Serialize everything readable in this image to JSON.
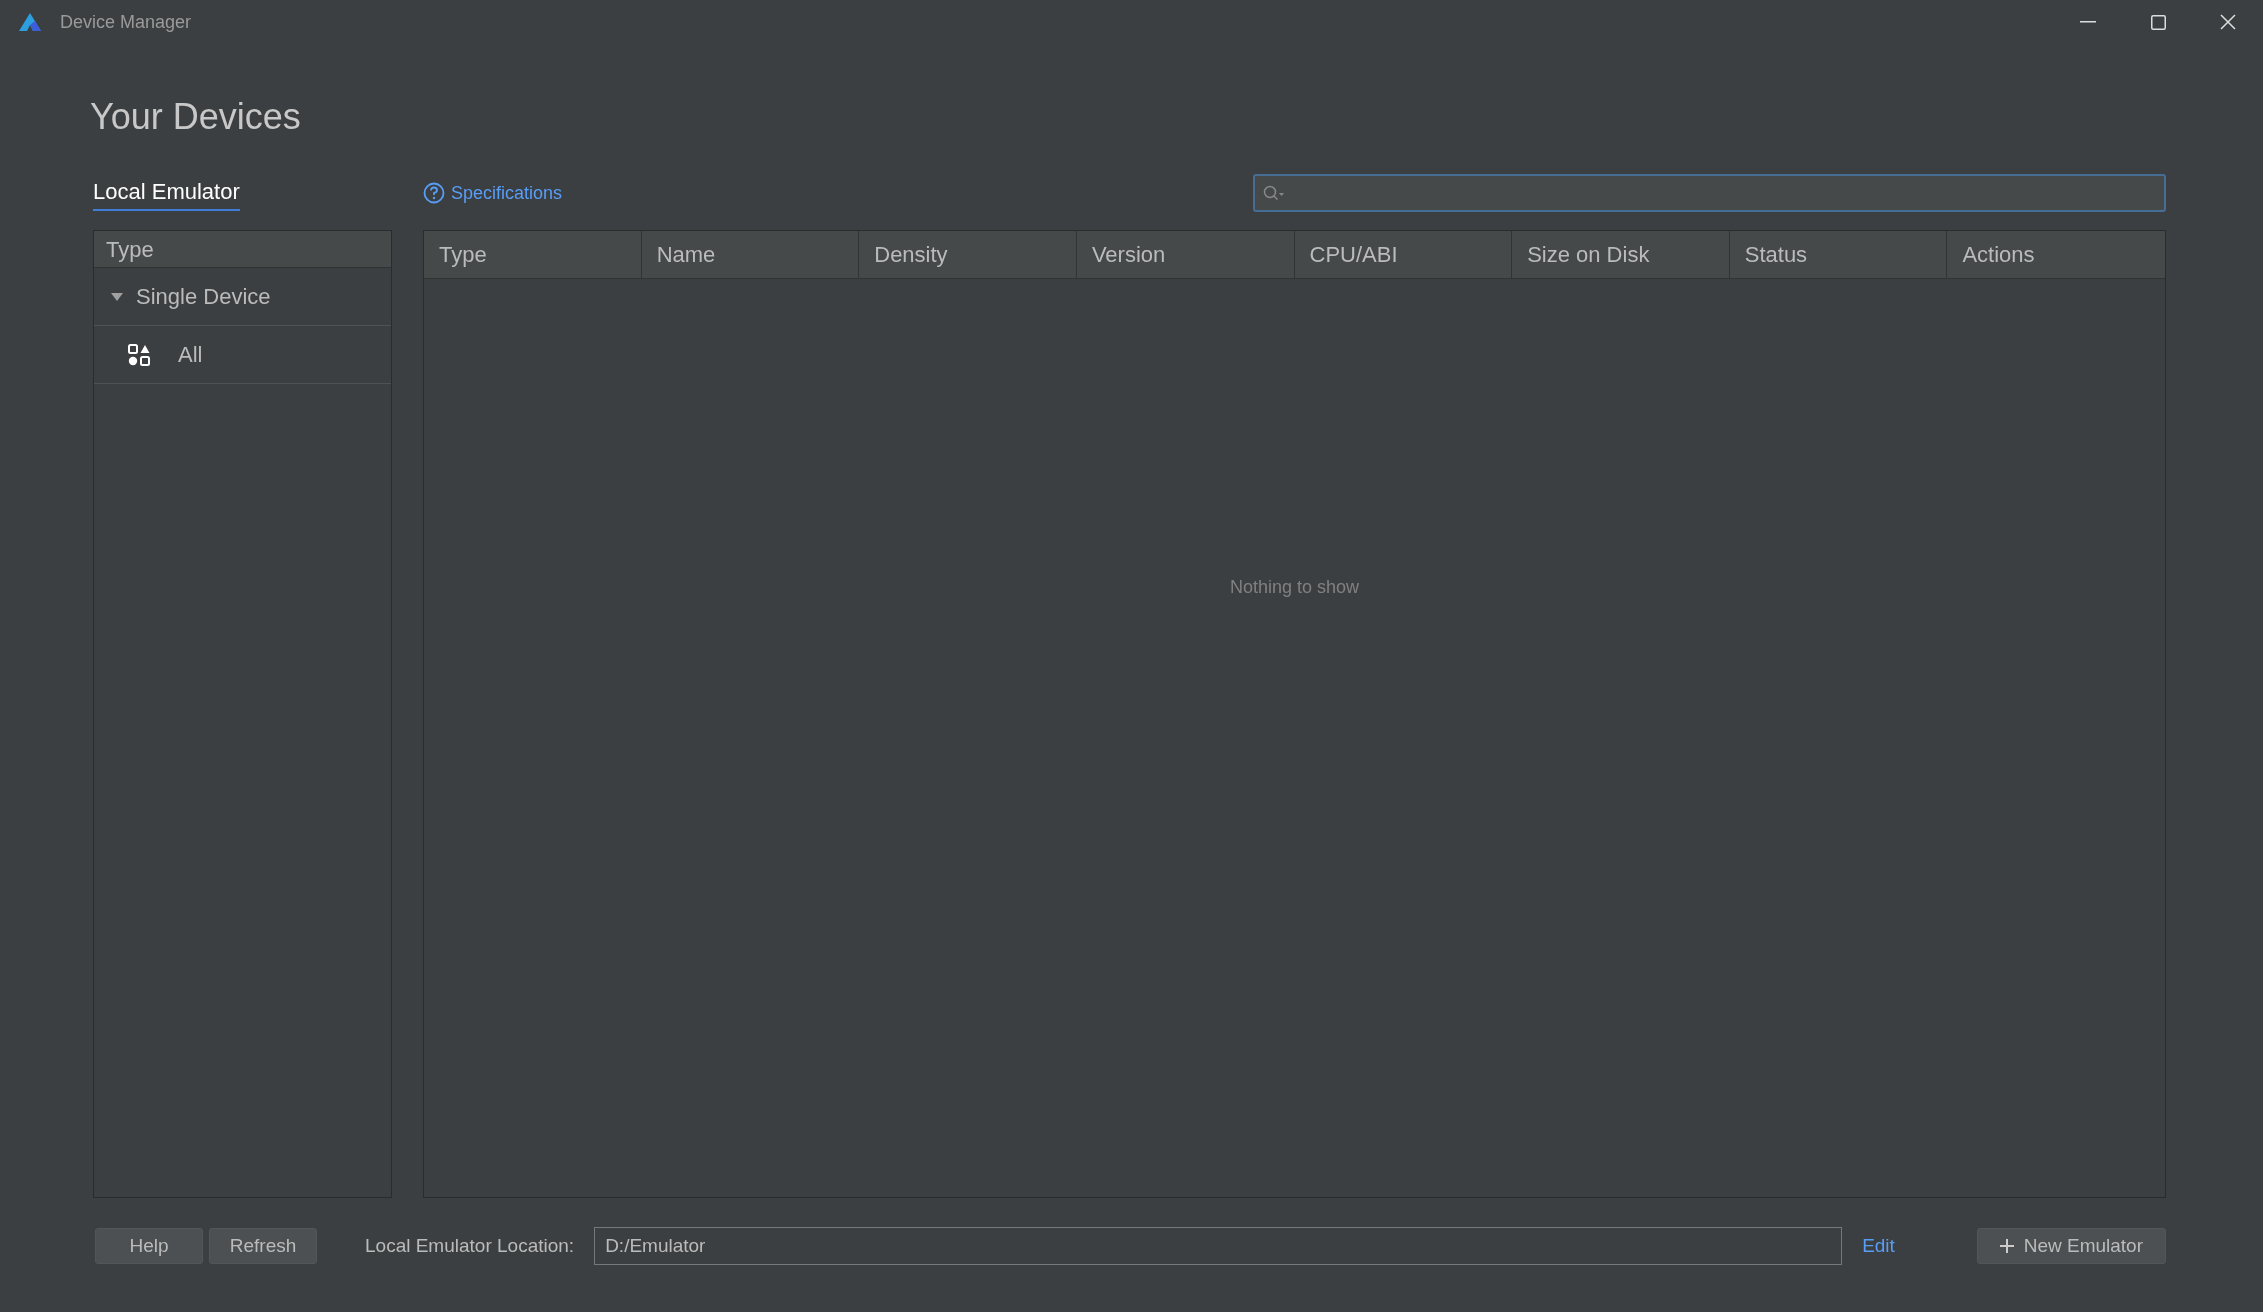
{
  "window": {
    "title": "Device Manager"
  },
  "heading": "Your Devices",
  "tabs": [
    {
      "label": "Local Emulator",
      "selected": true
    }
  ],
  "specifications_link": "Specifications",
  "sidebar": {
    "header": "Type",
    "tree": [
      {
        "label": "Single Device",
        "expanded": true,
        "children": [
          {
            "label": "All"
          }
        ]
      }
    ]
  },
  "table": {
    "columns": [
      "Type",
      "Name",
      "Density",
      "Version",
      "CPU/ABI",
      "Size on Disk",
      "Status",
      "Actions"
    ],
    "empty_message": "Nothing to show"
  },
  "footer": {
    "buttons": [
      "Help",
      "Refresh"
    ],
    "location_label": "Local Emulator Location:",
    "location_value": "D:/Emulator",
    "edit_link": "Edit",
    "new_button": "New Emulator"
  }
}
